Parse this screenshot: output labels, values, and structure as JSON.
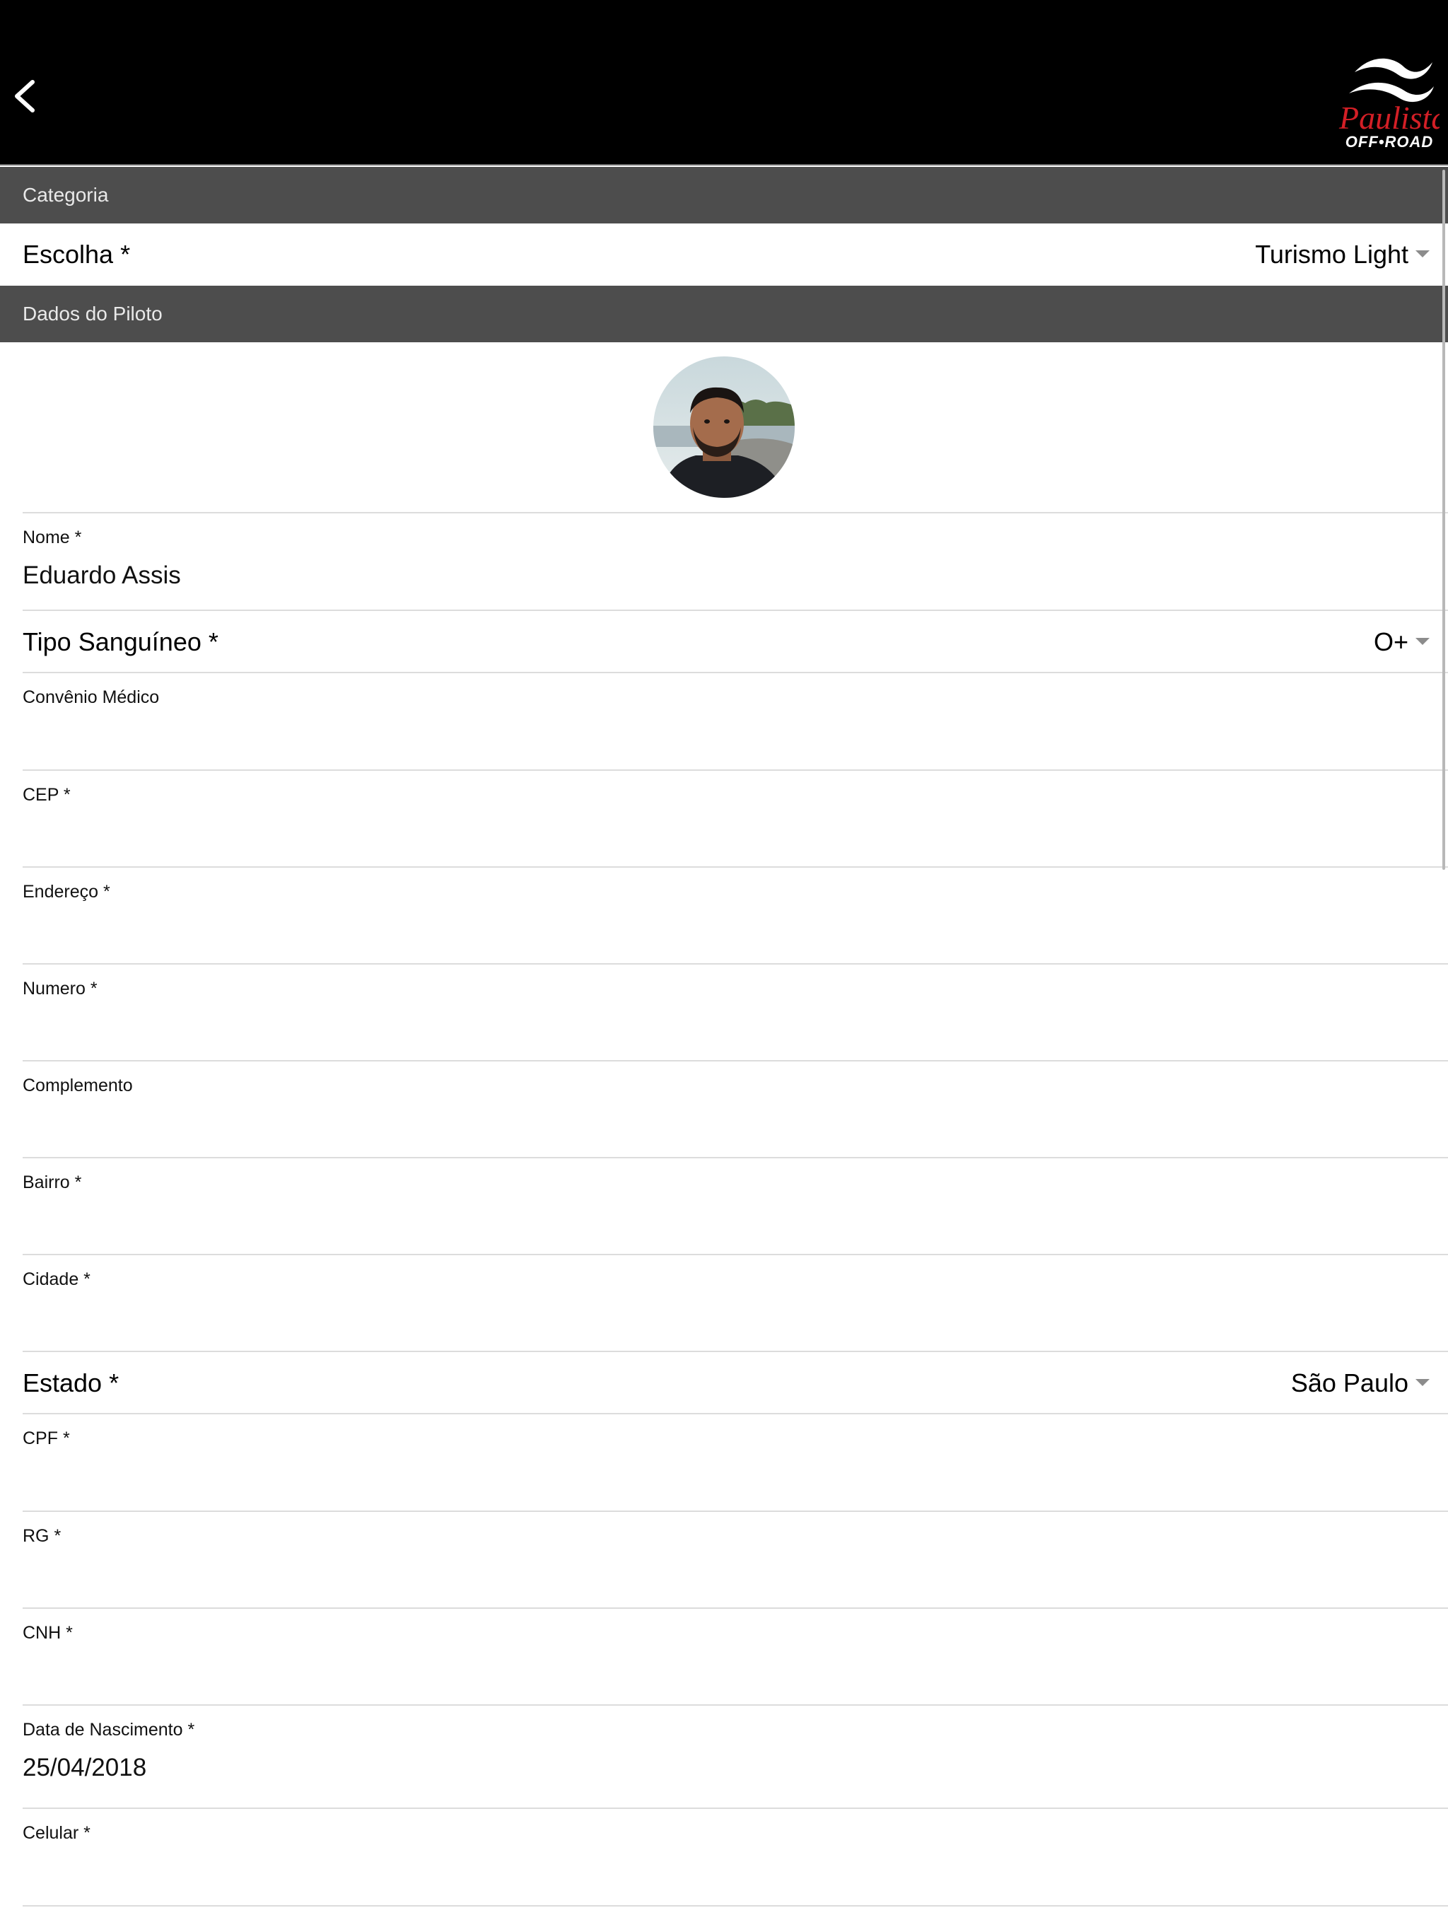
{
  "header": {
    "back_icon": "chevron-left-icon",
    "logo_script": "Paulista",
    "logo_sub": "OFF•ROAD",
    "logo_brand_color": "#d31f26"
  },
  "sections": {
    "categoria": "Categoria",
    "dados_piloto": "Dados do Piloto"
  },
  "categoria": {
    "escolha_label": "Escolha *",
    "escolha_value": "Turismo Light"
  },
  "fields": {
    "nome": {
      "label": "Nome *",
      "value": "Eduardo Assis"
    },
    "tipo_sanguineo": {
      "label": "Tipo Sanguíneo *",
      "value": "O+"
    },
    "convenio": {
      "label": "Convênio Médico",
      "value": ""
    },
    "cep": {
      "label": "CEP *",
      "value": ""
    },
    "endereco": {
      "label": "Endereço *",
      "value": ""
    },
    "numero": {
      "label": "Numero *",
      "value": ""
    },
    "complemento": {
      "label": "Complemento",
      "value": ""
    },
    "bairro": {
      "label": "Bairro *",
      "value": ""
    },
    "cidade": {
      "label": "Cidade *",
      "value": ""
    },
    "estado": {
      "label": "Estado *",
      "value": "São Paulo"
    },
    "cpf": {
      "label": "CPF *",
      "value": ""
    },
    "rg": {
      "label": "RG *",
      "value": ""
    },
    "cnh": {
      "label": "CNH *",
      "value": ""
    },
    "nascimento": {
      "label": "Data de Nascimento *",
      "value": "25/04/2018"
    },
    "celular": {
      "label": "Celular *",
      "value": ""
    }
  },
  "colors": {
    "header_bg": "#000000",
    "section_bg": "#4d4d4d",
    "section_text": "#e9e9e9",
    "divider": "#dcdcdc",
    "caret": "#8c8c8c"
  }
}
